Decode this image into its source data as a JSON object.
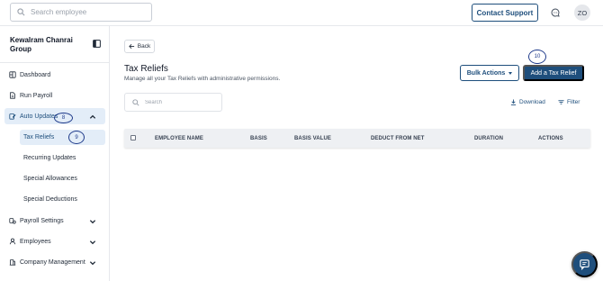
{
  "header": {
    "search_placeholder": "Search employee",
    "support_label": "Contact Support",
    "avatar_initials": "ZO"
  },
  "sidebar": {
    "company_name": "Kewalram Chanrai Group",
    "items": [
      {
        "label": "Dashboard",
        "icon": "dashboard-icon"
      },
      {
        "label": "Run Payroll",
        "icon": "payroll-document-icon"
      },
      {
        "label": "Auto Updates",
        "icon": "edit-icon",
        "expanded": true
      },
      {
        "label": "Payroll Settings",
        "icon": "payroll-settings-icon"
      },
      {
        "label": "Employees",
        "icon": "user-icon"
      },
      {
        "label": "Company Management",
        "icon": "company-icon"
      }
    ],
    "subitems": [
      {
        "label": "Tax Reliefs",
        "active": true
      },
      {
        "label": "Recurring Updates"
      },
      {
        "label": "Special Allowances"
      },
      {
        "label": "Special Deductions"
      }
    ]
  },
  "annotations": {
    "auto_updates_marker": "8",
    "tax_reliefs_marker": "9",
    "add_button_marker": "10",
    "marker_color": "#1e3a8a"
  },
  "main": {
    "back_label": "Back",
    "title": "Tax Reliefs",
    "description": "Manage all your Tax Reliefs with administrative permissions.",
    "bulk_actions_label": "Bulk Actions",
    "add_label": "Add a Tax Relief",
    "search_placeholder": "Search",
    "download_label": "Download",
    "filter_label": "Filter",
    "columns": [
      "EMPLOYEE NAME",
      "BASIS",
      "BASIS VALUE",
      "DEDUCT FROM NET",
      "DURATION",
      "ACTIONS"
    ]
  },
  "colors": {
    "primary": "#1e4e7c",
    "active_bg": "#e3edf8",
    "table_header_bg": "#eef0f3"
  }
}
